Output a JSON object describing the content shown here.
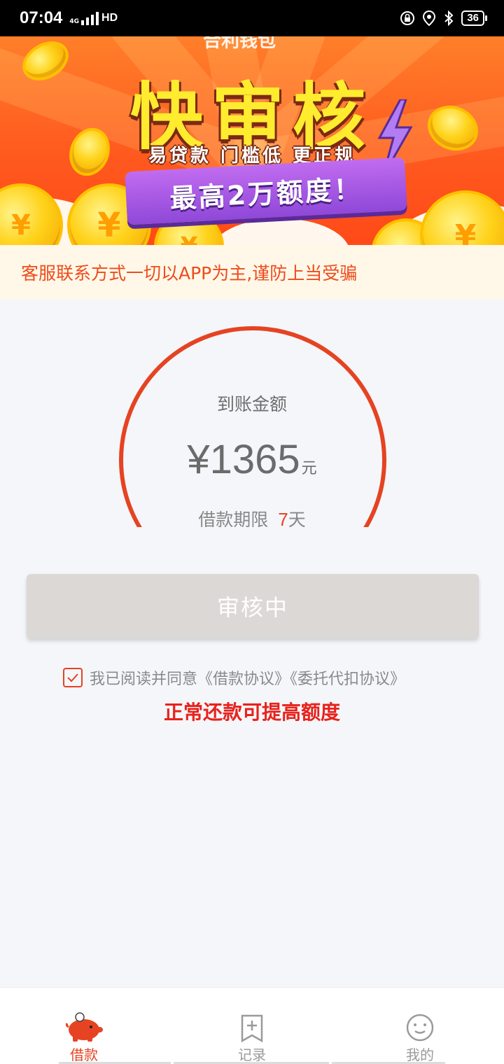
{
  "status_bar": {
    "time": "07:04",
    "network": "4G",
    "hd": "HD",
    "battery": "36"
  },
  "banner": {
    "top_text": "合利钱包",
    "title": "快审核",
    "subtitle": "易贷款 门槛低 更正规",
    "ribbon": "最高2万额度！"
  },
  "notice": "客服联系方式一切以APP为主,谨防上当受骗",
  "amount": {
    "label": "到账金额",
    "value": "¥1365",
    "unit": "元",
    "term_label": "借款期限",
    "term_days": "7",
    "term_unit": "天"
  },
  "review_button": "审核中",
  "agreement": "我已阅读并同意《借款协议》《委托代扣协议》",
  "hint": "正常还款可提高额度",
  "tabs": [
    {
      "label": "借款",
      "icon": "piggy-bank-icon",
      "active": true
    },
    {
      "label": "记录",
      "icon": "record-add-icon",
      "active": false
    },
    {
      "label": "我的",
      "icon": "smiley-profile-icon",
      "active": false
    }
  ],
  "colors": {
    "accent": "#e54322",
    "notice_bg": "#fff8e8",
    "button_disabled": "#dcd8d6"
  }
}
